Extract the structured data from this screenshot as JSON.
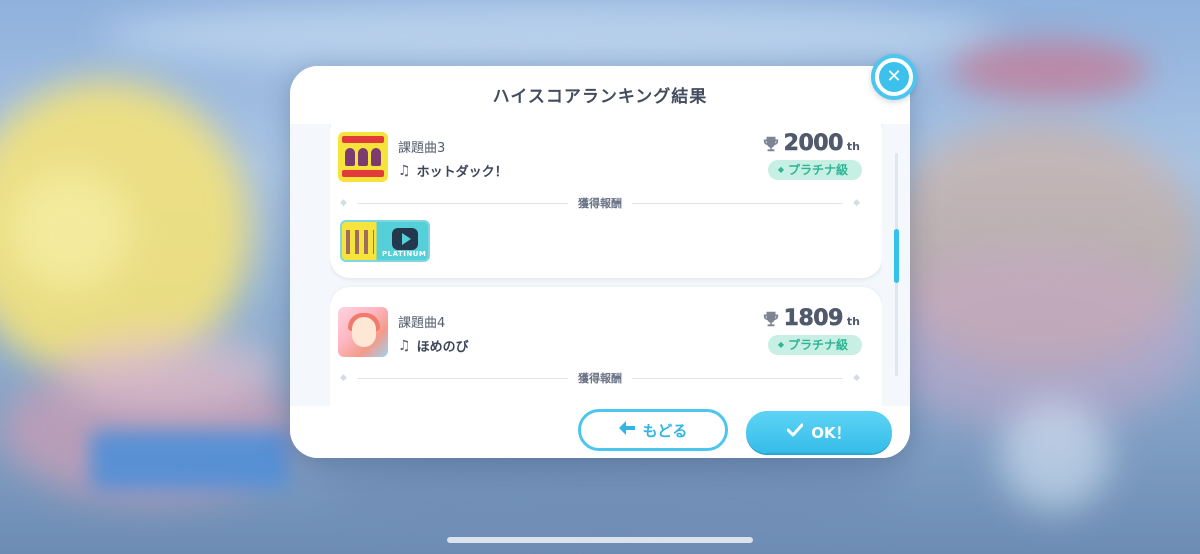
{
  "modal": {
    "title": "ハイスコアランキング結果",
    "reward_label": "獲得報酬",
    "cards": [
      {
        "song_sub": "課題曲3",
        "song_name": "ホットダック！",
        "rank_number": "2000",
        "rank_suffix": "th",
        "tier": "プラチナ級",
        "reward_text": "PLATINUM"
      },
      {
        "song_sub": "課題曲4",
        "song_name": "ほめのび",
        "rank_number": "1809",
        "rank_suffix": "th",
        "tier": "プラチナ級"
      }
    ]
  },
  "buttons": {
    "back_label": "もどる",
    "ok_label": "OK！"
  },
  "icons": {
    "close": "close-icon",
    "back": "arrow-left-icon",
    "ok": "check-icon",
    "note": "music-note-icon",
    "trophy": "trophy-icon"
  },
  "colors": {
    "accent": "#3cc0ec",
    "tier_bg": "#c7efe4",
    "tier_text": "#2fb593"
  }
}
